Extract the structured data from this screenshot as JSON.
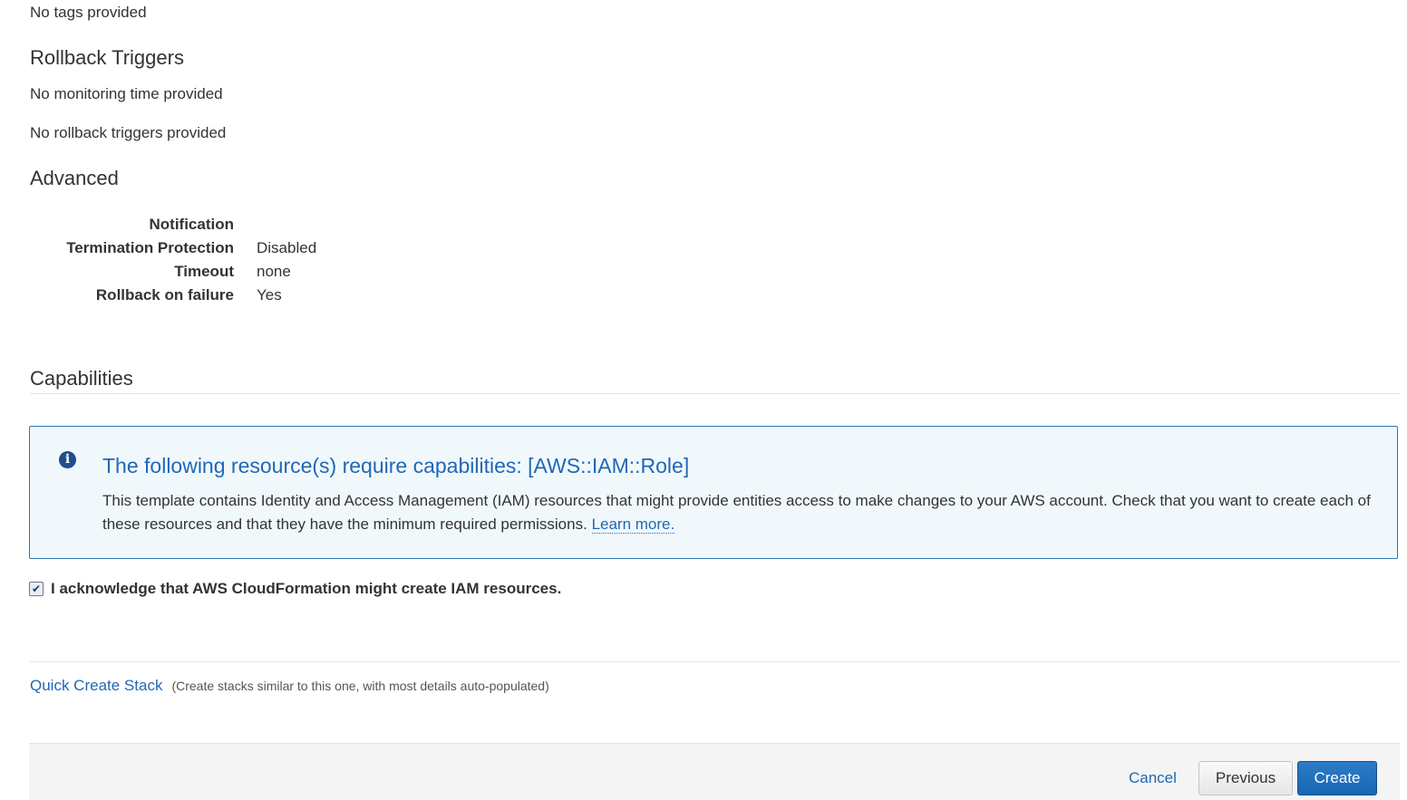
{
  "tags": {
    "empty_text": "No tags provided"
  },
  "rollback_triggers": {
    "heading": "Rollback Triggers",
    "monitoring_text": "No monitoring time provided",
    "triggers_text": "No rollback triggers provided"
  },
  "advanced": {
    "heading": "Advanced",
    "rows": [
      {
        "label": "Notification",
        "value": ""
      },
      {
        "label": "Termination Protection",
        "value": "Disabled"
      },
      {
        "label": "Timeout",
        "value": "none"
      },
      {
        "label": "Rollback on failure",
        "value": "Yes"
      }
    ]
  },
  "capabilities": {
    "heading": "Capabilities",
    "info": {
      "icon": "info-icon",
      "title": "The following resource(s) require capabilities: [AWS::IAM::Role]",
      "body": "This template contains Identity and Access Management (IAM) resources that might provide entities access to make changes to your AWS account. Check that you want to create each of these resources and that they have the minimum required permissions.",
      "link_label": "Learn more."
    },
    "acknowledge": {
      "checked": true,
      "label": "I acknowledge that AWS CloudFormation might create IAM resources."
    }
  },
  "quick_create": {
    "link_label": "Quick Create Stack",
    "note": "(Create stacks similar to this one, with most details auto-populated)"
  },
  "footer": {
    "cancel_label": "Cancel",
    "previous_label": "Previous",
    "create_label": "Create"
  },
  "colors": {
    "accent": "#1f68b6",
    "primary_button": "#1966b3",
    "info_background": "#f1f8fc",
    "info_border": "#2b73b4"
  }
}
